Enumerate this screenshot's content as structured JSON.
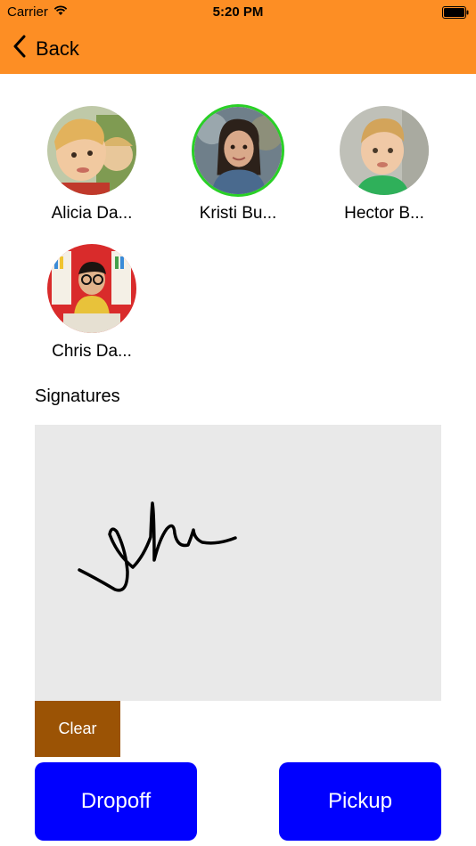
{
  "colors": {
    "accent": "#fd8e24",
    "selected_ring": "#29d026",
    "clear_bg": "#9b5305",
    "action_bg": "#0000ff"
  },
  "status_bar": {
    "carrier": "Carrier",
    "time": "5:20 PM",
    "wifi_icon": "wifi-icon",
    "battery_icon": "battery-icon"
  },
  "nav": {
    "back_label": "Back",
    "back_icon": "chevron-left-icon"
  },
  "children": [
    {
      "name": "Alicia Da...",
      "selected": false
    },
    {
      "name": "Kristi Bu...",
      "selected": true
    },
    {
      "name": "Hector B...",
      "selected": false
    },
    {
      "name": "Chris Da...",
      "selected": false
    }
  ],
  "signatures": {
    "label": "Signatures"
  },
  "buttons": {
    "clear": "Clear",
    "dropoff": "Dropoff",
    "pickup": "Pickup"
  }
}
